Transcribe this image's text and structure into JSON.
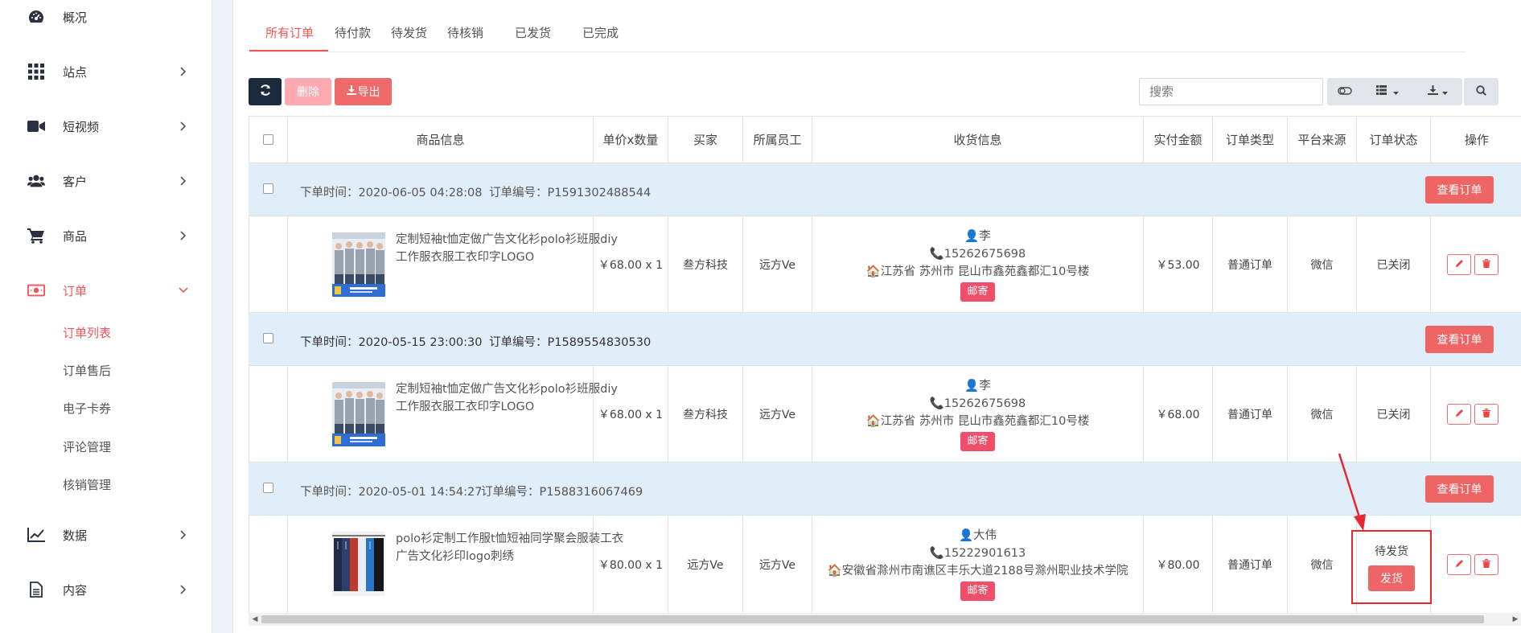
{
  "sidebar": {
    "items": [
      {
        "label": "概况",
        "icon": "dashboard-icon",
        "has_chevron": false
      },
      {
        "label": "站点",
        "icon": "grid-icon",
        "has_chevron": true
      },
      {
        "label": "短视频",
        "icon": "video-camera-icon",
        "has_chevron": true
      },
      {
        "label": "客户",
        "icon": "users-icon",
        "has_chevron": true
      },
      {
        "label": "商品",
        "icon": "shopping-cart-icon",
        "has_chevron": true
      },
      {
        "label": "订单",
        "icon": "money-icon",
        "has_chevron": true,
        "expanded": true
      },
      {
        "label": "数据",
        "icon": "line-chart-icon",
        "has_chevron": true
      },
      {
        "label": "内容",
        "icon": "document-icon",
        "has_chevron": true
      }
    ],
    "sub_items": [
      {
        "label": "订单列表",
        "active": true
      },
      {
        "label": "订单售后",
        "active": false
      },
      {
        "label": "电子卡券",
        "active": false
      },
      {
        "label": "评论管理",
        "active": false
      },
      {
        "label": "核销管理",
        "active": false
      }
    ]
  },
  "tabs": [
    {
      "label": "所有订单",
      "active": true
    },
    {
      "label": "待付款",
      "active": false
    },
    {
      "label": "待发货",
      "active": false
    },
    {
      "label": "待核销",
      "active": false
    },
    {
      "label": "已发货",
      "active": false
    },
    {
      "label": "已完成",
      "active": false
    }
  ],
  "toolbar": {
    "refresh_icon": "refresh-icon",
    "delete_label": "删除",
    "export_label": "导出",
    "search_placeholder": "搜索"
  },
  "table": {
    "headers": [
      "商品信息",
      "单价x数量",
      "买家",
      "所属员工",
      "收货信息",
      "实付金额",
      "订单类型",
      "平台来源",
      "订单状态",
      "操作"
    ],
    "orders": [
      {
        "time_label": "下单时间：2020-06-05 04:28:08",
        "number_label": "订单编号：P1591302488544",
        "view_label": "查看订单",
        "product": "定制短袖t恤定做广告文化衫polo衫班服diy工作服衣服工衣印字LOGO",
        "price_qty": "￥68.00 x 1",
        "buyer": "叁方科技",
        "staff": "远方Ve",
        "recipient": "李",
        "phone": "15262675698",
        "address": "江苏省 苏州市 昆山市鑫苑鑫都汇10号楼",
        "ship_tag": "邮寄",
        "amount": "￥53.00",
        "order_type": "普通订单",
        "platform": "微信",
        "status": "已关闭"
      },
      {
        "time_label": "下单时间：2020-05-15 23:00:30",
        "number_label": "订单编号：P1589554830530",
        "view_label": "查看订单",
        "product": "定制短袖t恤定做广告文化衫polo衫班服diy工作服衣服工衣印字LOGO",
        "price_qty": "￥68.00 x 1",
        "buyer": "叁方科技",
        "staff": "远方Ve",
        "recipient": "李",
        "phone": "15262675698",
        "address": "江苏省 苏州市 昆山市鑫苑鑫都汇10号楼",
        "ship_tag": "邮寄",
        "amount": "￥68.00",
        "order_type": "普通订单",
        "platform": "微信",
        "status": "已关闭"
      },
      {
        "time_label": "下单时间：2020-05-01 14:54:27",
        "number_label": "订单编号：P1588316067469",
        "view_label": "查看订单",
        "product": "polo衫定制工作服t恤短袖同学聚会服装工衣广告文化衫印logo刺绣",
        "price_qty": "￥80.00 x 1",
        "buyer": "远方Ve",
        "staff": "远方Ve",
        "recipient": "大伟",
        "phone": "15222901613",
        "address": "安徽省滁州市南谯区丰乐大道2188号滁州职业技术学院",
        "ship_tag": "邮寄",
        "amount": "￥80.00",
        "order_type": "普通订单",
        "platform": "微信",
        "status": "待发货",
        "ship_button": "发货"
      }
    ]
  },
  "colors": {
    "accent": "#f05656",
    "group_bg": "#e0eefa",
    "dark_button": "#1c2a3f",
    "annotation": "#e8262e"
  }
}
